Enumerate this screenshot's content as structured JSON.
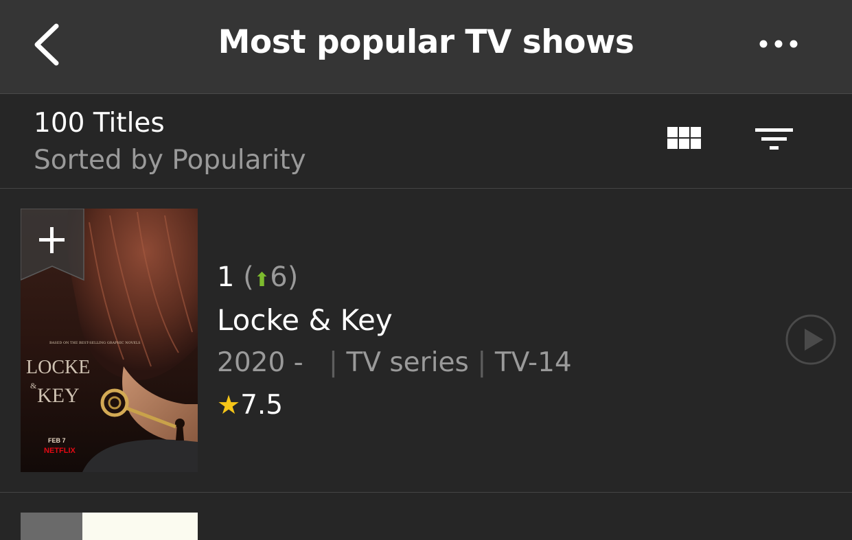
{
  "nav": {
    "title": "Most popular TV shows"
  },
  "summary": {
    "count": "100 Titles",
    "sorted": "Sorted by Popularity"
  },
  "items": [
    {
      "rank": "1",
      "rank_change": "6",
      "rank_direction": "up",
      "title": "Locke & Key",
      "year": "2020 -",
      "type": "TV series",
      "certificate": "TV-14",
      "rating": "7.5",
      "poster": {
        "tagline": "BASED ON THE BEST-SELLING GRAPHIC NOVELS",
        "title_line1": "LOCKE",
        "title_amp": "&",
        "title_line2": "KEY",
        "date": "FEB 7",
        "brand": "NETFLIX"
      }
    }
  ],
  "colors": {
    "nav_bg": "#353535",
    "page_bg": "#262626",
    "rank_up": "#7dbb2e",
    "star": "#f5c518",
    "secondary_text": "#9a9a9a"
  },
  "icons": {
    "back": "chevron-left-icon",
    "more": "more-dots-icon",
    "grid": "grid-view-icon",
    "filter": "filter-icon",
    "add": "plus-icon",
    "play": "play-circle-icon",
    "star": "star-icon",
    "arrow": "arrow-up-icon"
  }
}
